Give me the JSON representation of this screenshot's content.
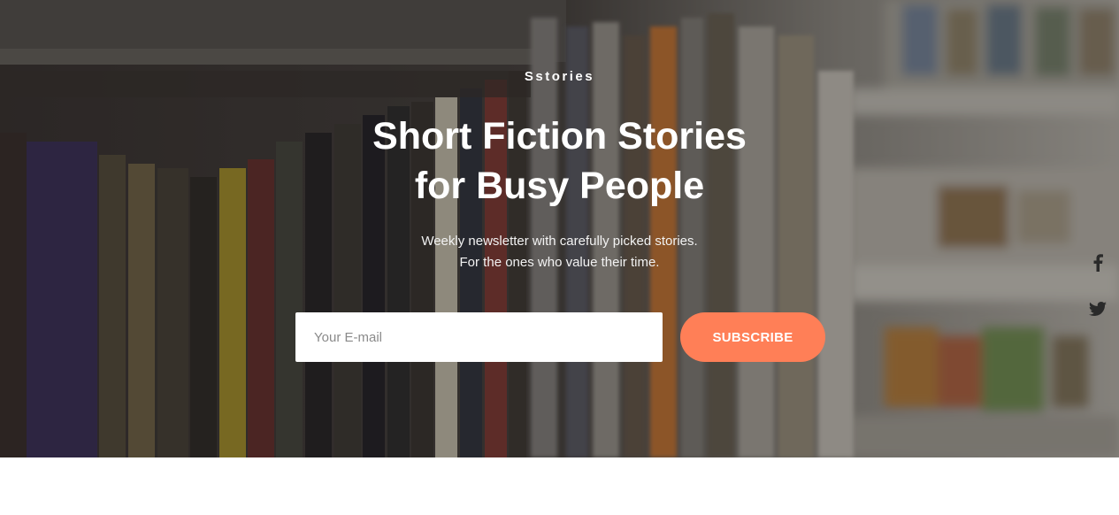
{
  "hero": {
    "brand": "Sstories",
    "headline_line1": "Short Fiction Stories",
    "headline_line2": "for Busy People",
    "subline_line1": "Weekly newsletter with carefully picked stories.",
    "subline_line2": "For the ones who value their time.",
    "background_image": "bookshelf-photo"
  },
  "form": {
    "email_placeholder": "Your E-mail",
    "email_value": "",
    "subscribe_label": "SUBSCRIBE"
  },
  "social": [
    {
      "icon": "facebook-icon"
    },
    {
      "icon": "twitter-icon"
    }
  ],
  "colors": {
    "accent": "#ff7f57",
    "text_light": "#ffffff",
    "page_background": "#ffffff"
  }
}
